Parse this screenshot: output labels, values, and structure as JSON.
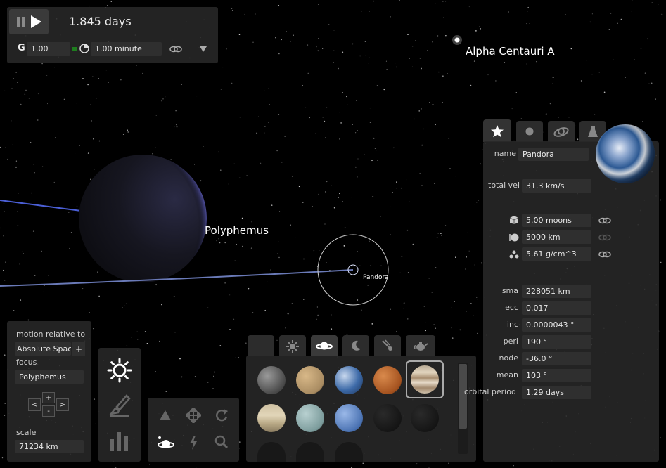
{
  "time_panel": {
    "elapsed": "1.845 days",
    "gravity_label": "G",
    "gravity_value": "1.00",
    "timestep_value": "1.00 minute"
  },
  "scene": {
    "star_label": "Alpha Centauri A",
    "planet_label": "Polyphemus",
    "moon_label": "Pandora"
  },
  "view_panel": {
    "motion_label": "motion relative to",
    "motion_value": "Absolute Spac",
    "focus_label": "focus",
    "focus_value": "Polyphemus",
    "scale_label": "scale",
    "scale_value": "71234 km",
    "plus": "+",
    "minus": "-",
    "prev": "<",
    "next": ">"
  },
  "body_panel": {
    "fields": {
      "name": {
        "label": "name",
        "value": "Pandora"
      },
      "total_vel": {
        "label": "total vel",
        "value": "31.3 km/s"
      },
      "mass": {
        "value": "5.00 moons"
      },
      "radius": {
        "value": "5000 km"
      },
      "density": {
        "value": "5.61 g/cm^3"
      },
      "sma": {
        "label": "sma",
        "value": "228051 km"
      },
      "ecc": {
        "label": "ecc",
        "value": "0.017"
      },
      "inc": {
        "label": "inc",
        "value": "0.0000043 °"
      },
      "peri": {
        "label": "peri",
        "value": "190 °"
      },
      "node": {
        "label": "node",
        "value": "-36.0 °"
      },
      "mean": {
        "label": "mean",
        "value": "103 °"
      },
      "period": {
        "label": "orbital period",
        "value": "1.29 days"
      }
    }
  },
  "colors": {
    "panel": "#282828",
    "field": "#2f2f2f",
    "orbit_line": "#4b5fd6",
    "planet_rim": "#6e6ee6"
  },
  "icons": [
    "pause-icon",
    "play-icon",
    "clock-icon",
    "link-icon",
    "dropdown-icon",
    "star-icon",
    "circle-icon",
    "orbit-icon",
    "flask-icon",
    "sun-icon",
    "brush-icon",
    "bar-chart-icon",
    "triangle-icon",
    "move-icon",
    "rotate-icon",
    "planet-icon",
    "lightning-icon",
    "zoom-icon",
    "moon-icon",
    "comet-icon",
    "teapot-icon",
    "cube-icon",
    "sphere-icon",
    "molecule-icon"
  ]
}
